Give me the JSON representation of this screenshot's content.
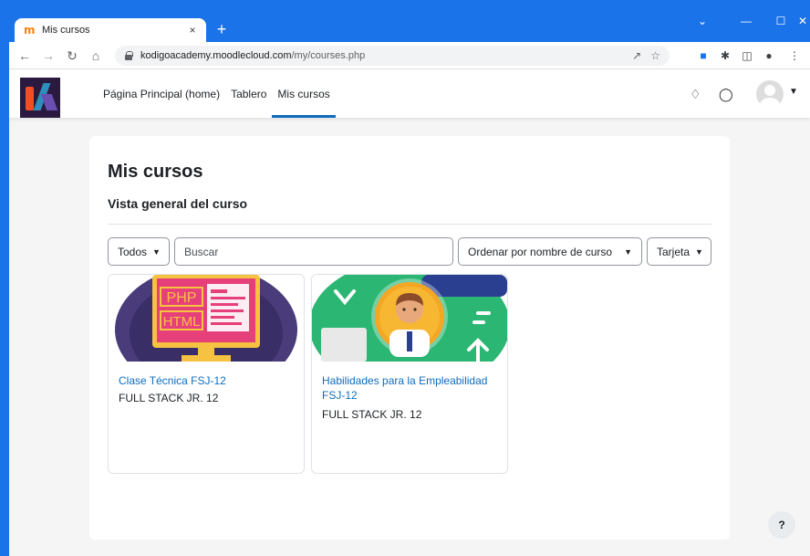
{
  "browser": {
    "tab_title": "Mis cursos",
    "tab_favicon": "m",
    "tab_close": "×",
    "new_tab": "+",
    "url_host": "kodigoacademy.moodlecloud.com",
    "url_path": "/my/courses.php"
  },
  "header": {
    "nav": [
      {
        "label": "Página Principal (home)",
        "active": false
      },
      {
        "label": "Tablero",
        "active": false
      },
      {
        "label": "Mis cursos",
        "active": true
      }
    ]
  },
  "main": {
    "title": "Mis cursos",
    "subtitle": "Vista general del curso",
    "filter_label": "Todos",
    "search_placeholder": "Buscar",
    "sort_label": "Ordenar por nombre de curso",
    "view_label": "Tarjeta"
  },
  "courses": [
    {
      "name": "Clase Técnica FSJ-12",
      "category": "FULL STACK JR. 12",
      "image_text_1": "PHP",
      "image_text_2": "HTML"
    },
    {
      "name": "Habilidades para la Empleabilidad FSJ-12",
      "category": "FULL STACK JR. 12"
    }
  ],
  "help_label": "?",
  "colors": {
    "brand_link": "#0f6cbf",
    "browser_frame": "#1a73e8",
    "page_bg": "#f5f5f5"
  }
}
